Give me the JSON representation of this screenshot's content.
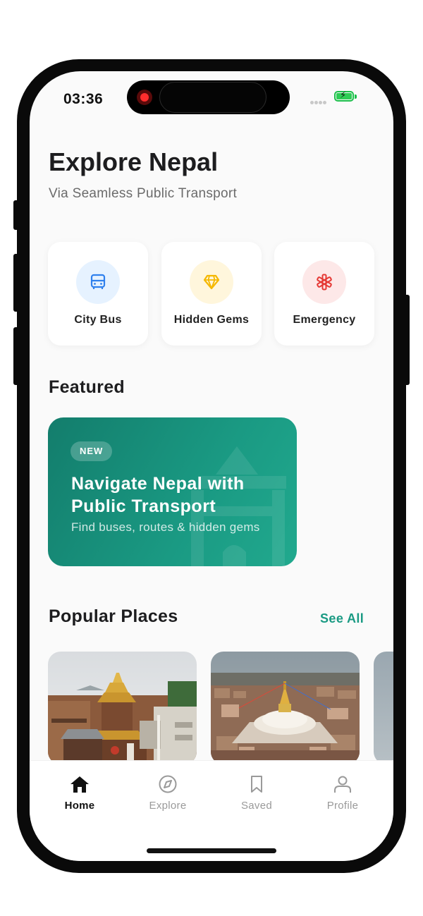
{
  "status_bar": {
    "time": "03:36"
  },
  "header": {
    "title": "Explore Nepal",
    "subtitle": "Via Seamless Public Transport"
  },
  "quick_actions": [
    {
      "label": "City Bus",
      "icon": "bus-icon",
      "color": "#2f80ed",
      "bg": "#e6f2ff"
    },
    {
      "label": "Hidden Gems",
      "icon": "diamond-icon",
      "color": "#f5b800",
      "bg": "#fff6dc"
    },
    {
      "label": "Emergency",
      "icon": "medical-icon",
      "color": "#e53935",
      "bg": "#fde8e8"
    }
  ],
  "featured": {
    "heading": "Featured",
    "badge": "NEW",
    "title": "Navigate Nepal with Public Transport",
    "subtitle": "Find buses, routes & hidden gems",
    "accent": "#1a9a83"
  },
  "popular": {
    "heading": "Popular Places",
    "see_all": "See All",
    "places": [
      {
        "image": "pashupatinath-temple-photo"
      },
      {
        "image": "boudhanath-stupa-photo"
      }
    ]
  },
  "nav": {
    "items": [
      {
        "label": "Home",
        "icon": "home-icon",
        "active": true
      },
      {
        "label": "Explore",
        "icon": "compass-icon",
        "active": false
      },
      {
        "label": "Saved",
        "icon": "bookmark-icon",
        "active": false
      },
      {
        "label": "Profile",
        "icon": "user-icon",
        "active": false
      }
    ]
  }
}
